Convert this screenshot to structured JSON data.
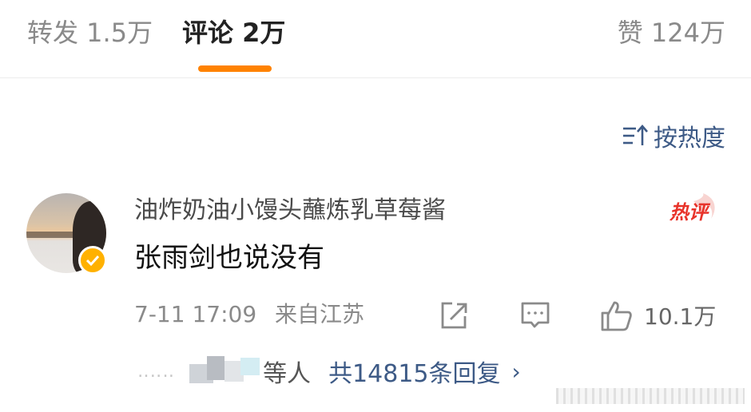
{
  "tabs": {
    "repost": "转发 1.5万",
    "comment": "评论 2万",
    "like": "赞 124万",
    "accent_color": "#ff8200"
  },
  "sort": {
    "label": "按热度",
    "icon": "sort-icon"
  },
  "comment": {
    "username": "油炸奶油小馒头蘸炼乳草莓酱",
    "hot_badge": "热评",
    "text": "张雨剑也说没有",
    "timestamp": "7-11 17:09",
    "source": "来自江苏",
    "like_count": "10.1万",
    "verified_color": "#ffb100"
  },
  "replies": {
    "suffix": "等人",
    "total": "共14815条回复"
  },
  "colors": {
    "link_blue": "#3d5a86",
    "hot_red": "#e8332a"
  }
}
